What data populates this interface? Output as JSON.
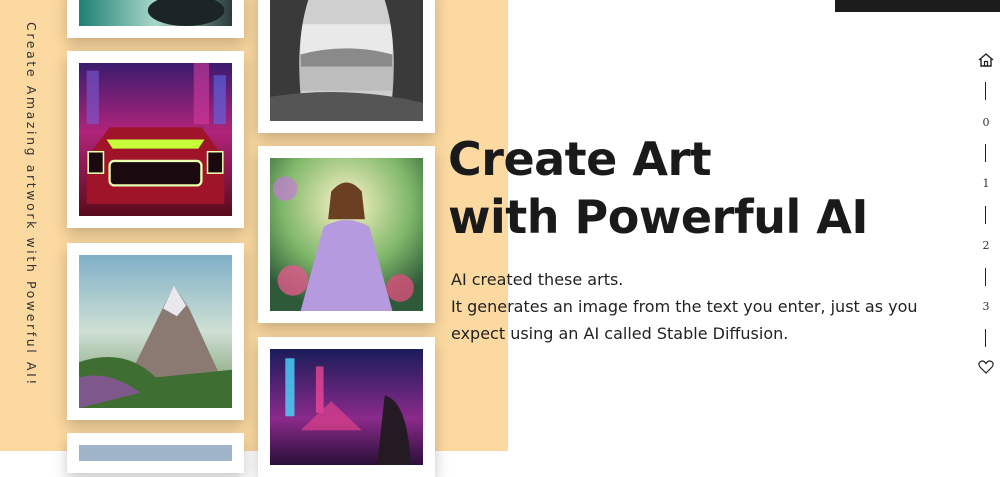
{
  "sidebar": {
    "tagline": "Create Amazing artwork with Powerful AI!"
  },
  "hero": {
    "title_line1": "Create Art",
    "title_line2": "with Powerful AI",
    "desc_line1": "AI created these arts.",
    "desc_line2": "It generates an image from the text you enter, just as you",
    "desc_line3": "expect using an AI called Stable Diffusion."
  },
  "nav": {
    "home_icon": "home-icon",
    "items": [
      "0",
      "1",
      "2",
      "3"
    ],
    "favorite_icon": "heart-icon"
  },
  "colors": {
    "panel_bg": "#fcd9a0",
    "text": "#1a1a1a",
    "top_bar": "#1c1c1c"
  }
}
